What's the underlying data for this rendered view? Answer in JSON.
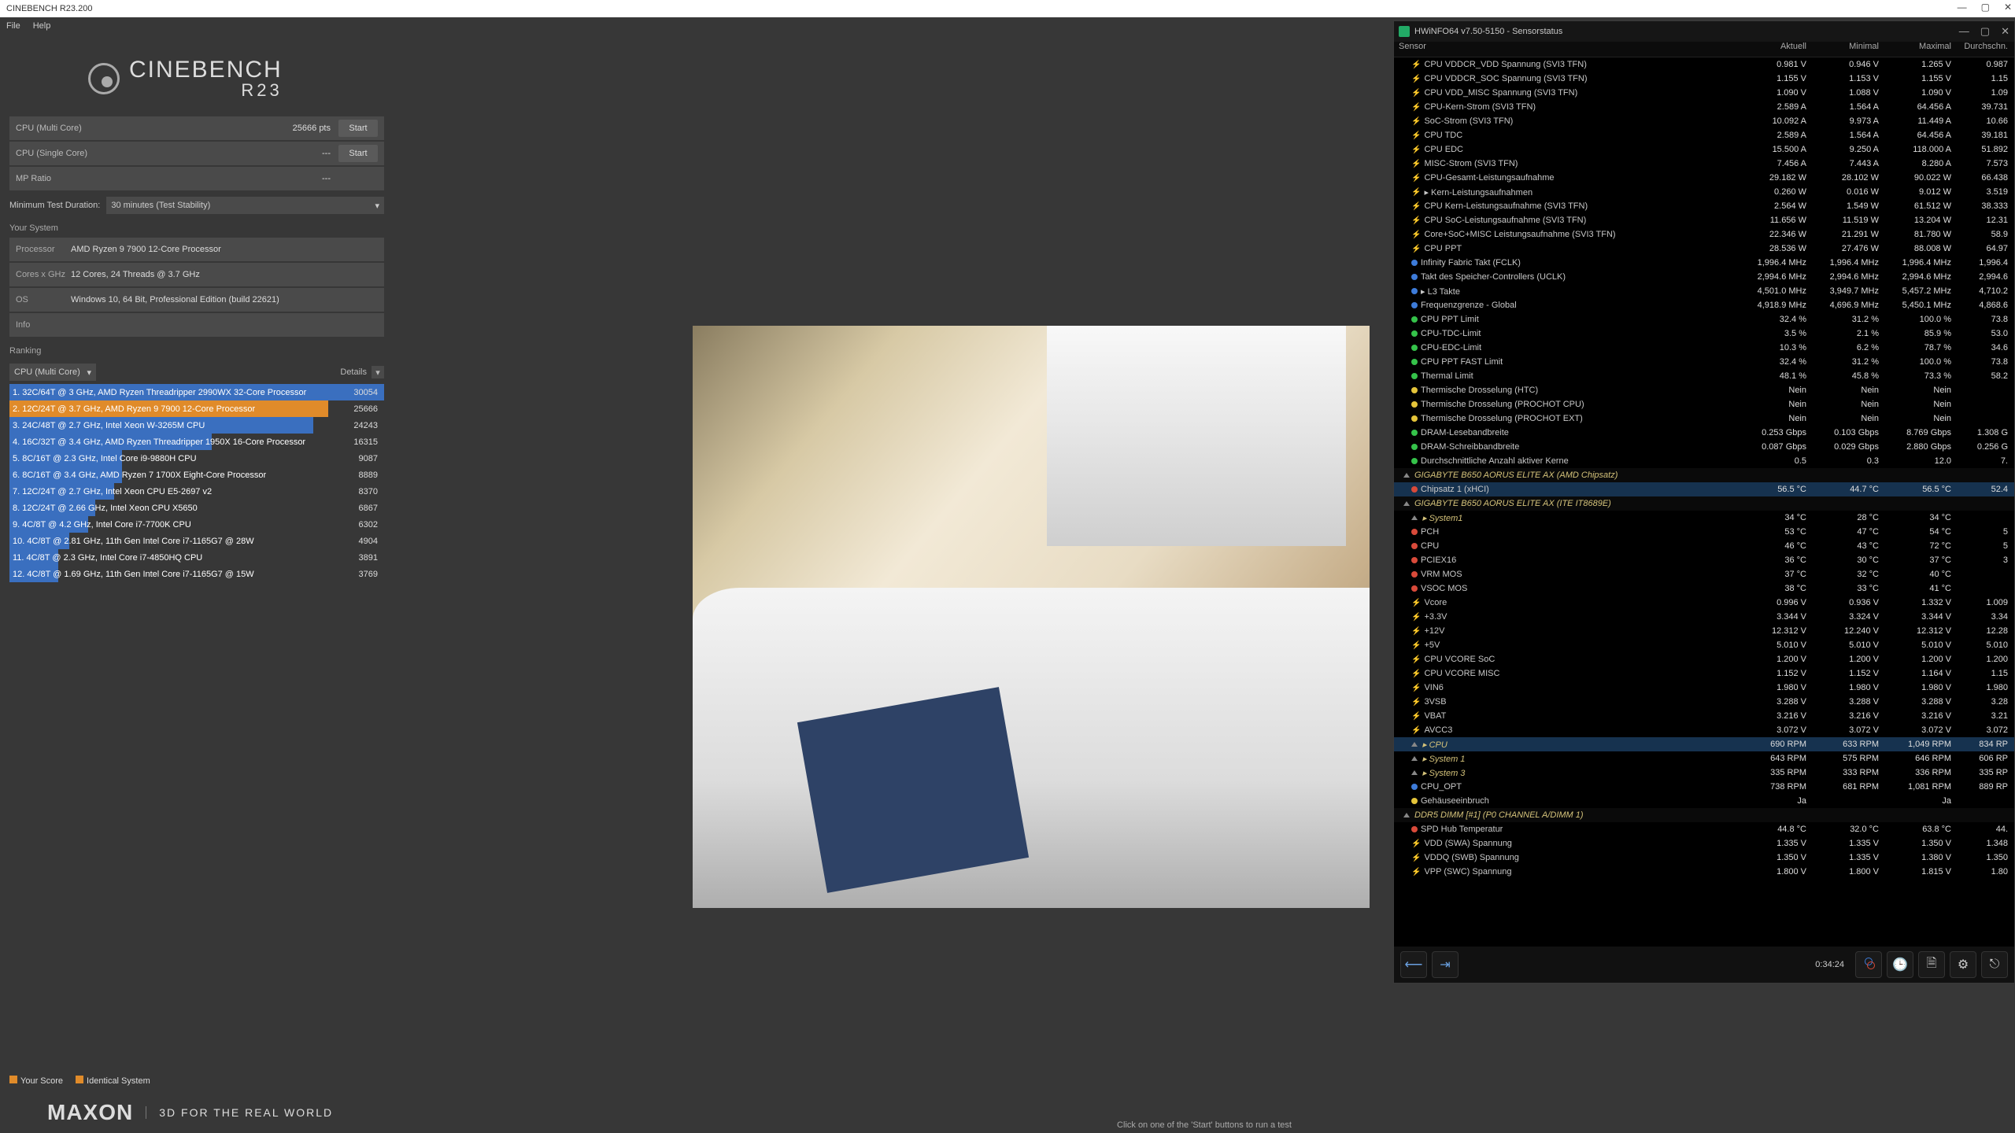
{
  "cinebench": {
    "title": "CINEBENCH R23.200",
    "menu": {
      "file": "File",
      "help": "Help"
    },
    "logo_big": "CINEBENCH",
    "logo_small": "R23",
    "tests": {
      "multi_label": "CPU (Multi Core)",
      "multi_score": "25666 pts",
      "single_label": "CPU (Single Core)",
      "single_score": "---",
      "mp_label": "MP Ratio",
      "mp_score": "---",
      "start": "Start"
    },
    "duration_label": "Minimum Test Duration:",
    "duration_value": "30 minutes (Test Stability)",
    "system_heading": "Your System",
    "system": {
      "processor_lbl": "Processor",
      "processor": "AMD Ryzen 9 7900 12-Core Processor",
      "cores_lbl": "Cores x GHz",
      "cores": "12 Cores, 24 Threads @ 3.7 GHz",
      "os_lbl": "OS",
      "os": "Windows 10, 64 Bit, Professional Edition (build 22621)",
      "info_lbl": "Info",
      "info": ""
    },
    "ranking_heading": "Ranking",
    "rank_mode": "CPU (Multi Core)",
    "rank_details": "Details",
    "ranking": [
      {
        "idx": "1.",
        "txt": "32C/64T @ 3 GHz, AMD Ryzen Threadripper 2990WX 32-Core Processor",
        "sc": "30054",
        "pct": 100,
        "cls": "rk-blue"
      },
      {
        "idx": "2.",
        "txt": "12C/24T @ 3.7 GHz, AMD Ryzen 9 7900 12-Core Processor",
        "sc": "25666",
        "pct": 85,
        "cls": "rk-orange"
      },
      {
        "idx": "3.",
        "txt": "24C/48T @ 2.7 GHz, Intel Xeon W-3265M CPU",
        "sc": "24243",
        "pct": 81,
        "cls": "rk-blue"
      },
      {
        "idx": "4.",
        "txt": "16C/32T @ 3.4 GHz, AMD Ryzen Threadripper 1950X 16-Core Processor",
        "sc": "16315",
        "pct": 54,
        "cls": "rk-blue"
      },
      {
        "idx": "5.",
        "txt": "8C/16T @ 2.3 GHz, Intel Core i9-9880H CPU",
        "sc": "9087",
        "pct": 30,
        "cls": "rk-blue"
      },
      {
        "idx": "6.",
        "txt": "8C/16T @ 3.4 GHz, AMD Ryzen 7 1700X Eight-Core Processor",
        "sc": "8889",
        "pct": 30,
        "cls": "rk-blue"
      },
      {
        "idx": "7.",
        "txt": "12C/24T @ 2.7 GHz, Intel Xeon CPU E5-2697 v2",
        "sc": "8370",
        "pct": 28,
        "cls": "rk-blue"
      },
      {
        "idx": "8.",
        "txt": "12C/24T @ 2.66 GHz, Intel Xeon CPU X5650",
        "sc": "6867",
        "pct": 23,
        "cls": "rk-blue"
      },
      {
        "idx": "9.",
        "txt": "4C/8T @ 4.2 GHz, Intel Core i7-7700K CPU",
        "sc": "6302",
        "pct": 21,
        "cls": "rk-blue"
      },
      {
        "idx": "10.",
        "txt": "4C/8T @ 2.81 GHz, 11th Gen Intel Core i7-1165G7 @ 28W",
        "sc": "4904",
        "pct": 16,
        "cls": "rk-blue"
      },
      {
        "idx": "11.",
        "txt": "4C/8T @ 2.3 GHz, Intel Core i7-4850HQ CPU",
        "sc": "3891",
        "pct": 13,
        "cls": "rk-blue"
      },
      {
        "idx": "12.",
        "txt": "4C/8T @ 1.69 GHz, 11th Gen Intel Core i7-1165G7 @ 15W",
        "sc": "3769",
        "pct": 13,
        "cls": "rk-blue"
      }
    ],
    "legend_your": "Your Score",
    "legend_identical": "Identical System",
    "maxon": "MAXON",
    "maxon_tag": "3D FOR THE REAL WORLD",
    "bottom_hint": "Click on one of the 'Start' buttons to run a test"
  },
  "hwinfo": {
    "title": "HWiNFO64 v7.50-5150 - Sensorstatus",
    "headers": {
      "sensor": "Sensor",
      "aktuell": "Aktuell",
      "minimal": "Minimal",
      "maximal": "Maximal",
      "durchschn": "Durchschn."
    },
    "rows": [
      {
        "t": "r",
        "d": "bolt",
        "n": "CPU VDDCR_VDD Spannung (SVI3 TFN)",
        "v": [
          "0.981 V",
          "0.946 V",
          "1.265 V",
          "0.987"
        ]
      },
      {
        "t": "r",
        "d": "bolt",
        "n": "CPU VDDCR_SOC Spannung (SVI3 TFN)",
        "v": [
          "1.155 V",
          "1.153 V",
          "1.155 V",
          "1.15"
        ]
      },
      {
        "t": "r",
        "d": "bolt",
        "n": "CPU VDD_MISC Spannung (SVI3 TFN)",
        "v": [
          "1.090 V",
          "1.088 V",
          "1.090 V",
          "1.09"
        ]
      },
      {
        "t": "r",
        "d": "bolt",
        "n": "CPU-Kern-Strom (SVI3 TFN)",
        "v": [
          "2.589 A",
          "1.564 A",
          "64.456 A",
          "39.731"
        ]
      },
      {
        "t": "r",
        "d": "bolt",
        "n": "SoC-Strom (SVI3 TFN)",
        "v": [
          "10.092 A",
          "9.973 A",
          "11.449 A",
          "10.66"
        ]
      },
      {
        "t": "r",
        "d": "bolt",
        "n": "CPU TDC",
        "v": [
          "2.589 A",
          "1.564 A",
          "64.456 A",
          "39.181"
        ]
      },
      {
        "t": "r",
        "d": "bolt",
        "n": "CPU EDC",
        "v": [
          "15.500 A",
          "9.250 A",
          "118.000 A",
          "51.892"
        ]
      },
      {
        "t": "r",
        "d": "bolt",
        "n": "MISC-Strom (SVI3 TFN)",
        "v": [
          "7.456 A",
          "7.443 A",
          "8.280 A",
          "7.573"
        ]
      },
      {
        "t": "r",
        "d": "bolt",
        "n": "CPU-Gesamt-Leistungsaufnahme",
        "v": [
          "29.182 W",
          "28.102 W",
          "90.022 W",
          "66.438"
        ]
      },
      {
        "t": "r",
        "d": "bolt",
        "n": "▸ Kern-Leistungsaufnahmen",
        "v": [
          "0.260 W",
          "0.016 W",
          "9.012 W",
          "3.519"
        ]
      },
      {
        "t": "r",
        "d": "bolt",
        "n": "CPU Kern-Leistungsaufnahme (SVI3 TFN)",
        "v": [
          "2.564 W",
          "1.549 W",
          "61.512 W",
          "38.333"
        ]
      },
      {
        "t": "r",
        "d": "bolt",
        "n": "CPU SoC-Leistungsaufnahme (SVI3 TFN)",
        "v": [
          "11.656 W",
          "11.519 W",
          "13.204 W",
          "12.31"
        ]
      },
      {
        "t": "r",
        "d": "bolt",
        "n": "Core+SoC+MISC Leistungsaufnahme (SVI3 TFN)",
        "v": [
          "22.346 W",
          "21.291 W",
          "81.780 W",
          "58.9"
        ]
      },
      {
        "t": "r",
        "d": "bolt",
        "n": "CPU PPT",
        "v": [
          "28.536 W",
          "27.476 W",
          "88.008 W",
          "64.97"
        ]
      },
      {
        "t": "r",
        "d": "db",
        "n": "Infinity Fabric Takt (FCLK)",
        "v": [
          "1,996.4 MHz",
          "1,996.4 MHz",
          "1,996.4 MHz",
          "1,996.4"
        ]
      },
      {
        "t": "r",
        "d": "db",
        "n": "Takt des Speicher-Controllers (UCLK)",
        "v": [
          "2,994.6 MHz",
          "2,994.6 MHz",
          "2,994.6 MHz",
          "2,994.6"
        ]
      },
      {
        "t": "r",
        "d": "db",
        "n": "▸ L3 Takte",
        "v": [
          "4,501.0 MHz",
          "3,949.7 MHz",
          "5,457.2 MHz",
          "4,710.2"
        ]
      },
      {
        "t": "r",
        "d": "db",
        "n": "Frequenzgrenze - Global",
        "v": [
          "4,918.9 MHz",
          "4,696.9 MHz",
          "5,450.1 MHz",
          "4,868.6"
        ]
      },
      {
        "t": "r",
        "d": "dg",
        "n": "CPU PPT Limit",
        "v": [
          "32.4 %",
          "31.2 %",
          "100.0 %",
          "73.8"
        ]
      },
      {
        "t": "r",
        "d": "dg",
        "n": "CPU-TDC-Limit",
        "v": [
          "3.5 %",
          "2.1 %",
          "85.9 %",
          "53.0"
        ]
      },
      {
        "t": "r",
        "d": "dg",
        "n": "CPU-EDC-Limit",
        "v": [
          "10.3 %",
          "6.2 %",
          "78.7 %",
          "34.6"
        ]
      },
      {
        "t": "r",
        "d": "dg",
        "n": "CPU PPT FAST Limit",
        "v": [
          "32.4 %",
          "31.2 %",
          "100.0 %",
          "73.8"
        ]
      },
      {
        "t": "r",
        "d": "dg",
        "n": "Thermal Limit",
        "v": [
          "48.1 %",
          "45.8 %",
          "73.3 %",
          "58.2"
        ]
      },
      {
        "t": "r",
        "d": "dy",
        "n": "Thermische Drosselung (HTC)",
        "v": [
          "Nein",
          "Nein",
          "Nein",
          ""
        ]
      },
      {
        "t": "r",
        "d": "dy",
        "n": "Thermische Drosselung (PROCHOT CPU)",
        "v": [
          "Nein",
          "Nein",
          "Nein",
          ""
        ]
      },
      {
        "t": "r",
        "d": "dy",
        "n": "Thermische Drosselung (PROCHOT EXT)",
        "v": [
          "Nein",
          "Nein",
          "Nein",
          ""
        ]
      },
      {
        "t": "r",
        "d": "dg",
        "n": "DRAM-Lesebandbreite",
        "v": [
          "0.253 Gbps",
          "0.103 Gbps",
          "8.769 Gbps",
          "1.308 G"
        ]
      },
      {
        "t": "r",
        "d": "dg",
        "n": "DRAM-Schreibbandbreite",
        "v": [
          "0.087 Gbps",
          "0.029 Gbps",
          "2.880 Gbps",
          "0.256 G"
        ]
      },
      {
        "t": "r",
        "d": "dg",
        "n": "Durchschnittliche Anzahl aktiver Kerne",
        "v": [
          "0.5",
          "0.3",
          "12.0",
          "7."
        ]
      },
      {
        "t": "g",
        "n": "GIGABYTE B650 AORUS ELITE AX (AMD Chipsatz)"
      },
      {
        "t": "r",
        "d": "dr",
        "n": "Chipsatz 1 (xHCI)",
        "v": [
          "56.5 °C",
          "44.7 °C",
          "56.5 °C",
          "52.4"
        ],
        "sel": true
      },
      {
        "t": "g",
        "n": "GIGABYTE B650 AORUS ELITE AX (ITE IT8689E)"
      },
      {
        "t": "p",
        "n": "▸ System1",
        "v": [
          "34 °C",
          "28 °C",
          "34 °C",
          ""
        ]
      },
      {
        "t": "r",
        "d": "dr",
        "n": "PCH",
        "v": [
          "53 °C",
          "47 °C",
          "54 °C",
          "5"
        ]
      },
      {
        "t": "r",
        "d": "dr",
        "n": "CPU",
        "v": [
          "46 °C",
          "43 °C",
          "72 °C",
          "5"
        ]
      },
      {
        "t": "r",
        "d": "dr",
        "n": "PCIEX16",
        "v": [
          "36 °C",
          "30 °C",
          "37 °C",
          "3"
        ]
      },
      {
        "t": "r",
        "d": "dr",
        "n": "VRM MOS",
        "v": [
          "37 °C",
          "32 °C",
          "40 °C",
          ""
        ]
      },
      {
        "t": "r",
        "d": "dr",
        "n": "VSOC MOS",
        "v": [
          "38 °C",
          "33 °C",
          "41 °C",
          ""
        ]
      },
      {
        "t": "r",
        "d": "bolt",
        "n": "Vcore",
        "v": [
          "0.996 V",
          "0.936 V",
          "1.332 V",
          "1.009"
        ]
      },
      {
        "t": "r",
        "d": "bolt",
        "n": "+3.3V",
        "v": [
          "3.344 V",
          "3.324 V",
          "3.344 V",
          "3.34"
        ]
      },
      {
        "t": "r",
        "d": "bolt",
        "n": "+12V",
        "v": [
          "12.312 V",
          "12.240 V",
          "12.312 V",
          "12.28"
        ]
      },
      {
        "t": "r",
        "d": "bolt",
        "n": "+5V",
        "v": [
          "5.010 V",
          "5.010 V",
          "5.010 V",
          "5.010"
        ]
      },
      {
        "t": "r",
        "d": "bolt",
        "n": "CPU VCORE SoC",
        "v": [
          "1.200 V",
          "1.200 V",
          "1.200 V",
          "1.200"
        ]
      },
      {
        "t": "r",
        "d": "bolt",
        "n": "CPU VCORE MISC",
        "v": [
          "1.152 V",
          "1.152 V",
          "1.164 V",
          "1.15"
        ]
      },
      {
        "t": "r",
        "d": "bolt",
        "n": "VIN6",
        "v": [
          "1.980 V",
          "1.980 V",
          "1.980 V",
          "1.980"
        ]
      },
      {
        "t": "r",
        "d": "bolt",
        "n": "3VSB",
        "v": [
          "3.288 V",
          "3.288 V",
          "3.288 V",
          "3.28"
        ]
      },
      {
        "t": "r",
        "d": "bolt",
        "n": "VBAT",
        "v": [
          "3.216 V",
          "3.216 V",
          "3.216 V",
          "3.21"
        ]
      },
      {
        "t": "r",
        "d": "bolt",
        "n": "AVCC3",
        "v": [
          "3.072 V",
          "3.072 V",
          "3.072 V",
          "3.072"
        ]
      },
      {
        "t": "p",
        "n": "▸ CPU",
        "v": [
          "690 RPM",
          "633 RPM",
          "1,049 RPM",
          "834 RP"
        ],
        "sel": true
      },
      {
        "t": "p",
        "n": "▸ System 1",
        "v": [
          "643 RPM",
          "575 RPM",
          "646 RPM",
          "606 RP"
        ]
      },
      {
        "t": "p",
        "n": "▸ System 3",
        "v": [
          "335 RPM",
          "333 RPM",
          "336 RPM",
          "335 RP"
        ]
      },
      {
        "t": "r",
        "d": "db",
        "n": "CPU_OPT",
        "v": [
          "738 RPM",
          "681 RPM",
          "1,081 RPM",
          "889 RP"
        ]
      },
      {
        "t": "r",
        "d": "dy",
        "n": "Gehäuseeinbruch",
        "v": [
          "Ja",
          "",
          "Ja",
          ""
        ]
      },
      {
        "t": "g",
        "n": "DDR5 DIMM [#1] (P0 CHANNEL A/DIMM 1)"
      },
      {
        "t": "r",
        "d": "dr",
        "n": "SPD Hub Temperatur",
        "v": [
          "44.8 °C",
          "32.0 °C",
          "63.8 °C",
          "44."
        ]
      },
      {
        "t": "r",
        "d": "bolt",
        "n": "VDD (SWA) Spannung",
        "v": [
          "1.335 V",
          "1.335 V",
          "1.350 V",
          "1.348"
        ]
      },
      {
        "t": "r",
        "d": "bolt",
        "n": "VDDQ (SWB) Spannung",
        "v": [
          "1.350 V",
          "1.335 V",
          "1.380 V",
          "1.350"
        ]
      },
      {
        "t": "r",
        "d": "bolt",
        "n": "VPP (SWC) Spannung",
        "v": [
          "1.800 V",
          "1.800 V",
          "1.815 V",
          "1.80"
        ]
      }
    ],
    "clock": "0:34:24"
  }
}
